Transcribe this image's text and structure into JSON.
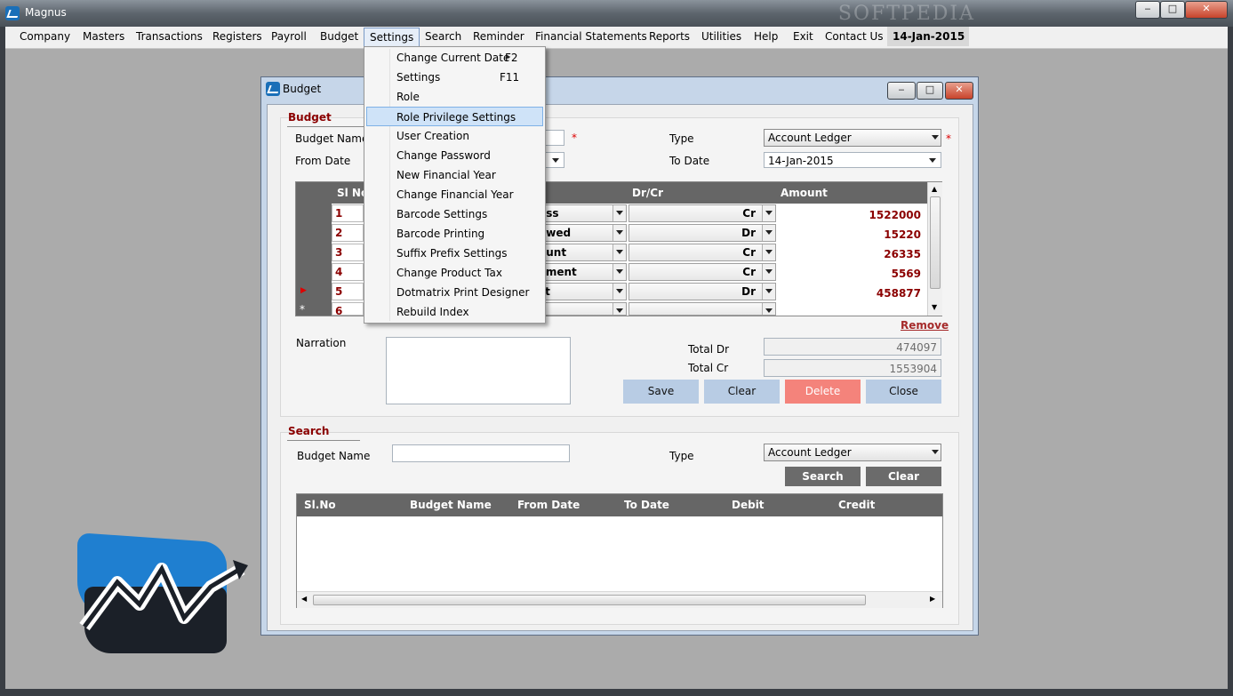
{
  "window": {
    "title": "Magnus",
    "watermark": "SOFTPEDIA"
  },
  "menubar": {
    "items": [
      "Company",
      "Masters",
      "Transactions",
      "Registers",
      "Payroll",
      "Budget",
      "Settings",
      "Search",
      "Reminder",
      "Financial Statements",
      "Reports",
      "Utilities",
      "Help",
      "Exit",
      "Contact Us"
    ],
    "date": "14-Jan-2015",
    "active": "Settings"
  },
  "settings_menu": {
    "items": [
      {
        "label": "Change Current Date",
        "shortcut": "F2"
      },
      {
        "label": "Settings",
        "shortcut": "F11"
      },
      {
        "label": "Role",
        "shortcut": ""
      },
      {
        "label": "Role Privilege Settings",
        "shortcut": ""
      },
      {
        "label": "User Creation",
        "shortcut": ""
      },
      {
        "label": "Change Password",
        "shortcut": ""
      },
      {
        "label": "New Financial Year",
        "shortcut": ""
      },
      {
        "label": "Change Financial Year",
        "shortcut": ""
      },
      {
        "label": "Barcode Settings",
        "shortcut": ""
      },
      {
        "label": "Barcode Printing",
        "shortcut": ""
      },
      {
        "label": "Suffix Prefix Settings",
        "shortcut": ""
      },
      {
        "label": "Change Product Tax",
        "shortcut": ""
      },
      {
        "label": "Dotmatrix Print Designer",
        "shortcut": ""
      },
      {
        "label": "Rebuild Index",
        "shortcut": ""
      }
    ],
    "highlighted": "Role Privilege Settings"
  },
  "budget_window": {
    "title": "Budget",
    "section_budget": "Budget",
    "budget_name_label": "Budget Name",
    "from_date_label": "From Date",
    "type_label": "Type",
    "type_value": "Account Ledger",
    "to_date_label": "To Date",
    "to_date_value": "14-Jan-2015",
    "required_mark": "*",
    "grid": {
      "headers": {
        "slno": "Sl No",
        "drcr": "Dr/Cr",
        "amount": "Amount"
      },
      "rows": [
        {
          "sn": "1",
          "ledger": "oss",
          "drcr": "Cr",
          "amount": "1522000"
        },
        {
          "sn": "2",
          "ledger": "owed",
          "drcr": "Dr",
          "amount": "15220"
        },
        {
          "sn": "3",
          "ledger": "ount",
          "drcr": "Cr",
          "amount": "26335"
        },
        {
          "sn": "4",
          "ledger": "yment",
          "drcr": "Cr",
          "amount": "5569"
        },
        {
          "sn": "5",
          "ledger": "st",
          "drcr": "Dr",
          "amount": "458877"
        },
        {
          "sn": "6",
          "ledger": "",
          "drcr": "",
          "amount": ""
        }
      ],
      "new_row_marker": "*",
      "current_row_marker": "▶"
    },
    "remove_label": "Remove",
    "narration_label": "Narration",
    "total_dr_label": "Total Dr",
    "total_dr_value": "474097",
    "total_cr_label": "Total Cr",
    "total_cr_value": "1553904",
    "buttons": {
      "save": "Save",
      "clear": "Clear",
      "delete": "Delete",
      "close": "Close"
    },
    "search": {
      "section": "Search",
      "budget_name_label": "Budget Name",
      "type_label": "Type",
      "type_value": "Account Ledger",
      "search_button": "Search",
      "clear_button": "Clear",
      "headers": [
        "Sl.No",
        "Budget Name",
        "From Date",
        "To Date",
        "Debit",
        "Credit"
      ]
    }
  },
  "colors": {
    "accent_red": "#8b0000",
    "grid_header": "#666666",
    "delete_button": "#f4837b",
    "primary_button": "#b8cce4"
  }
}
